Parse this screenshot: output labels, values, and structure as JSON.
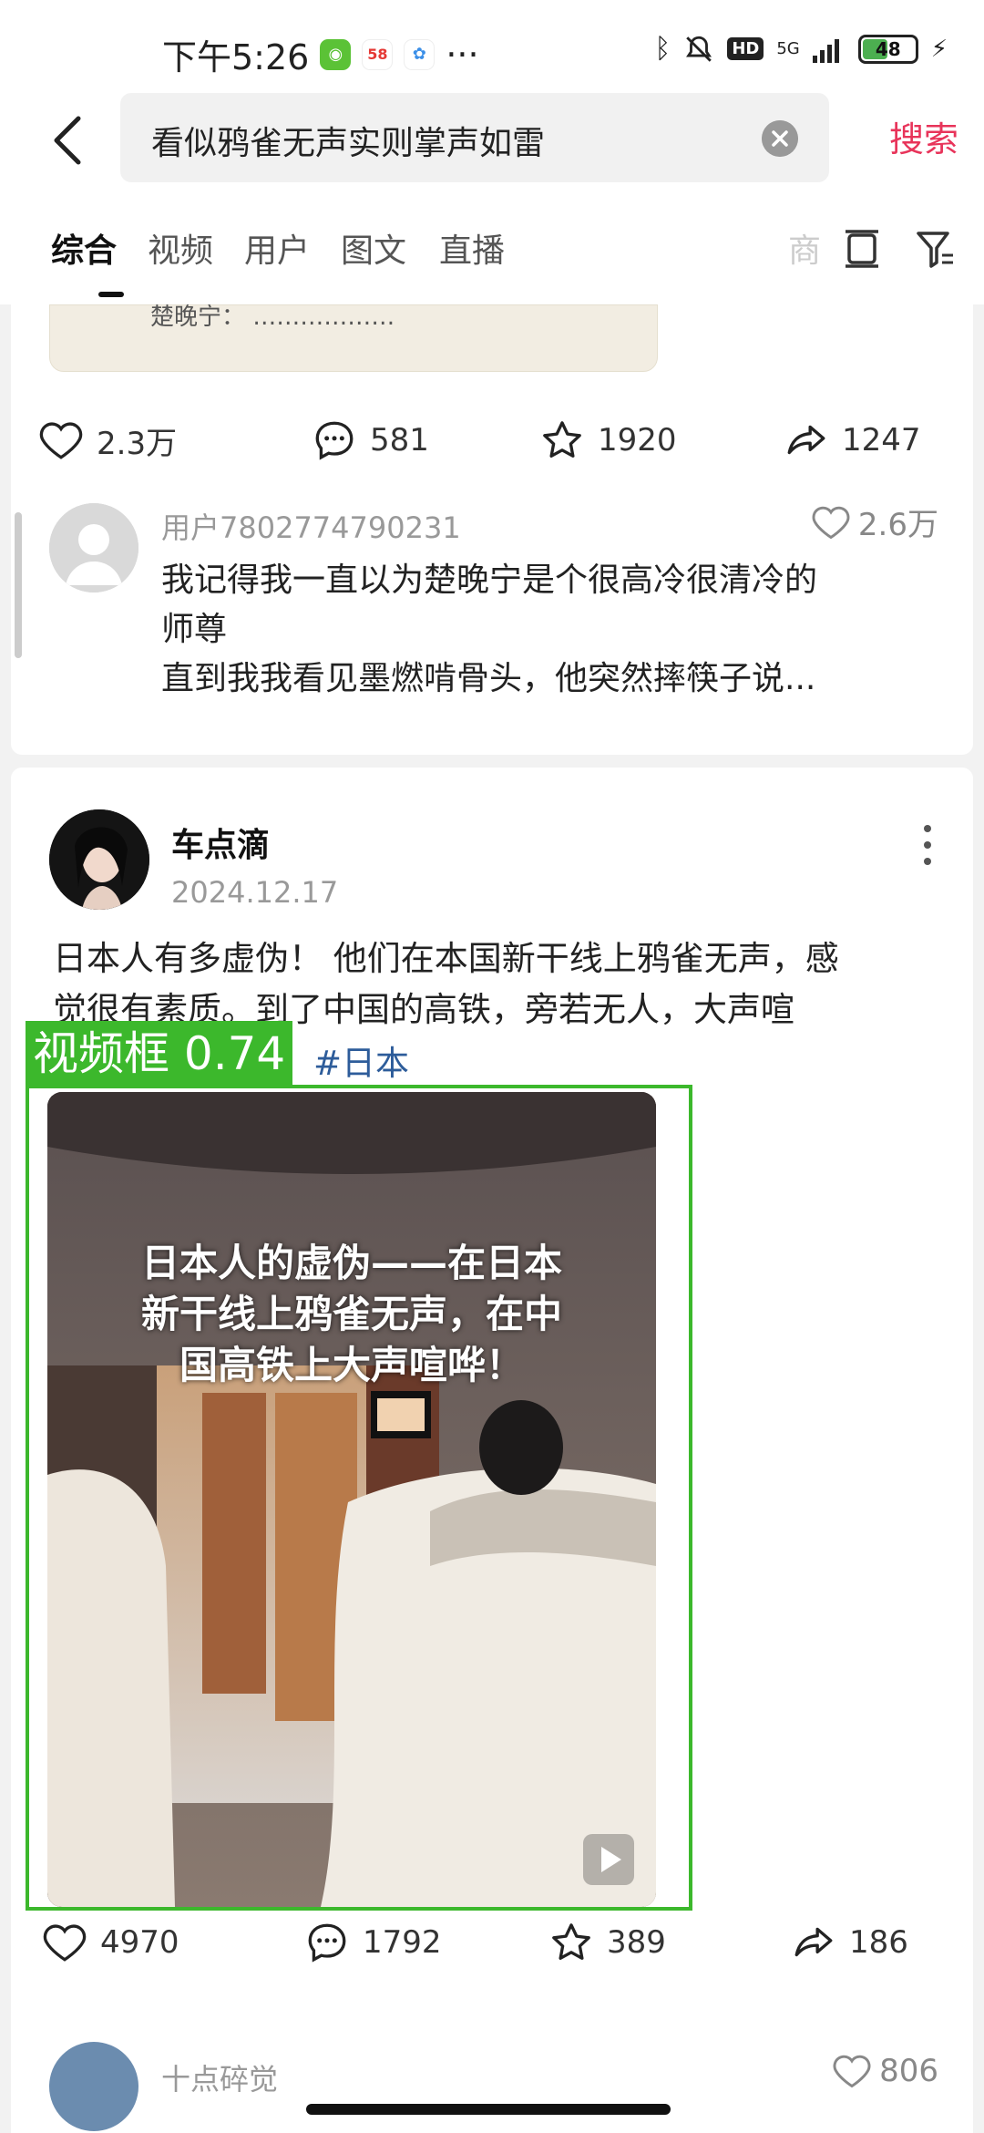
{
  "status_bar": {
    "time": "下午5:26",
    "more": "···",
    "signal_label": "5G",
    "hd": "HD",
    "battery": "48",
    "battery_level": 0.48
  },
  "search": {
    "query": "看似鸦雀无声实则掌声如雷",
    "button": "搜索"
  },
  "tabs": [
    "综合",
    "视频",
    "用户",
    "图文",
    "直播",
    "商"
  ],
  "quote_card": {
    "quote_text": "楚晚宁：  ………………",
    "actions": {
      "like": "2.3万",
      "comment": "581",
      "star": "1920",
      "share": "1247"
    }
  },
  "comment": {
    "user": "用户7802774790231",
    "likes": "2.6万",
    "lines": [
      "我记得我一直以为楚晚宁是个很高冷很清冷的",
      "师尊",
      "直到我我看见墨燃啃骨头，他突然摔筷子说..."
    ]
  },
  "post": {
    "author": "车点滴",
    "date": "2024.12.17",
    "text_line1": "日本人有多虚伪！ 他们在本国新干线上鸦雀无声，感",
    "text_line2": "觉很有素质。到了中国的高铁，旁若无人，大声喧",
    "hashtag": "#日本",
    "detect_label": "视频框 0.74",
    "video_caption": [
      "日本人的虚伪——在日本",
      "新干线上鸦雀无声，在中",
      "国高铁上大声喧哗！"
    ],
    "actions": {
      "like": "4970",
      "comment": "1792",
      "star": "389",
      "share": "186"
    }
  },
  "next_comment": {
    "user": "十点碎觉",
    "likes": "806"
  },
  "colors": {
    "accent": "#e8345a",
    "detect_green": "#3cb82c",
    "hashtag": "#2d5c9a"
  }
}
